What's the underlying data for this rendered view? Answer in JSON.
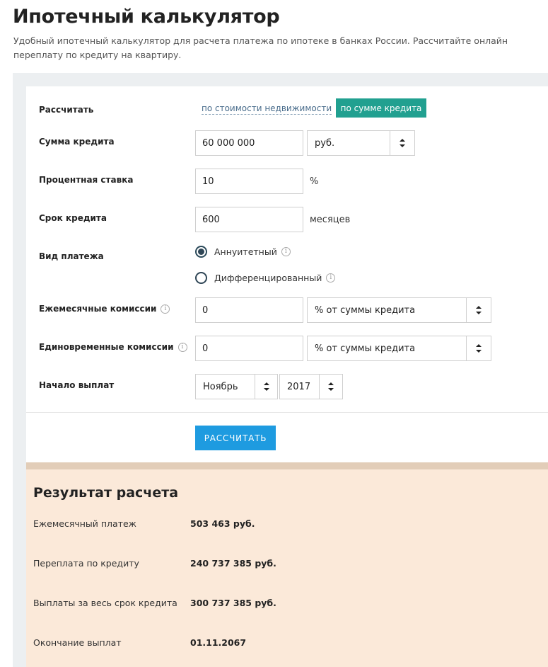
{
  "header": {
    "title": "Ипотечный калькулятор",
    "description": "Удобный ипотечный калькулятор для расчета платежа по ипотеке в банках России. Рассчитайте онлайн переплату по кредиту на квартиру."
  },
  "form": {
    "calc_mode": {
      "label": "Рассчитать",
      "options": [
        "по стоимости недвижимости",
        "по сумме кредита"
      ],
      "selected": "по сумме кредита"
    },
    "loan_amount": {
      "label": "Сумма кредита",
      "value": "60 000 000",
      "currency": "руб."
    },
    "interest_rate": {
      "label": "Процентная ставка",
      "value": "10",
      "unit": "%"
    },
    "loan_term": {
      "label": "Срок кредита",
      "value": "600",
      "unit": "месяцев"
    },
    "payment_type": {
      "label": "Вид платежа",
      "options": [
        "Аннуитетный",
        "Дифференцированный"
      ],
      "selected": "Аннуитетный"
    },
    "monthly_fees": {
      "label": "Ежемесячные комиссии",
      "value": "0",
      "basis": "% от суммы кредита"
    },
    "one_time_fees": {
      "label": "Единовременные комиссии",
      "value": "0",
      "basis": "% от суммы кредита"
    },
    "start": {
      "label": "Начало выплат",
      "month": "Ноябрь",
      "year": "2017"
    },
    "submit_label": "РАССЧИТАТЬ"
  },
  "result": {
    "title": "Результат расчета",
    "rows": [
      {
        "label": "Ежемесячный платеж",
        "value": "503 463 руб."
      },
      {
        "label": "Переплата по кредиту",
        "value": "240 737 385 руб."
      },
      {
        "label": "Выплаты за весь срок кредита",
        "value": "300 737 385 руб."
      },
      {
        "label": "Окончание выплат",
        "value": "01.11.2067"
      }
    ]
  },
  "colors": {
    "accent_tab": "#21a090",
    "button": "#1e9be0",
    "result_bg": "#fbe9d9"
  }
}
